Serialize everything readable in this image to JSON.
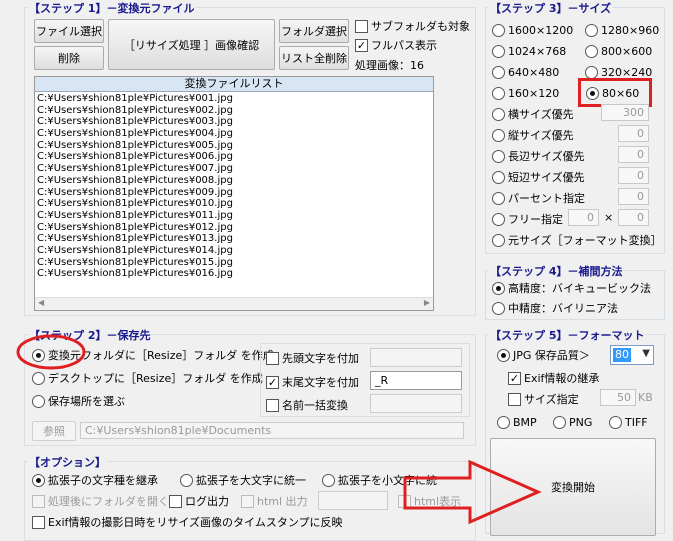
{
  "step1": {
    "title": "【ステップ 1】－変換元ファイル",
    "file_select": "ファイル選択",
    "delete": "削除",
    "resize_confirm": "［リサイズ処理 ］画像確認",
    "folder_select": "フォルダ選択",
    "list_clear": "リスト全削除",
    "subfolder_label": "サブフォルダも対象",
    "fullpath_label": "フルパス表示",
    "processed_label": "処理画像：",
    "processed_count": "16",
    "list_header": "変換ファイルリスト",
    "files": [
      "C:¥Users¥shion81ple¥Pictures¥001.jpg",
      "C:¥Users¥shion81ple¥Pictures¥002.jpg",
      "C:¥Users¥shion81ple¥Pictures¥003.jpg",
      "C:¥Users¥shion81ple¥Pictures¥004.jpg",
      "C:¥Users¥shion81ple¥Pictures¥005.jpg",
      "C:¥Users¥shion81ple¥Pictures¥006.jpg",
      "C:¥Users¥shion81ple¥Pictures¥007.jpg",
      "C:¥Users¥shion81ple¥Pictures¥008.jpg",
      "C:¥Users¥shion81ple¥Pictures¥009.jpg",
      "C:¥Users¥shion81ple¥Pictures¥010.jpg",
      "C:¥Users¥shion81ple¥Pictures¥011.jpg",
      "C:¥Users¥shion81ple¥Pictures¥012.jpg",
      "C:¥Users¥shion81ple¥Pictures¥013.jpg",
      "C:¥Users¥shion81ple¥Pictures¥014.jpg",
      "C:¥Users¥shion81ple¥Pictures¥015.jpg",
      "C:¥Users¥shion81ple¥Pictures¥016.jpg"
    ]
  },
  "step2": {
    "title": "【ステップ 2】－保存先",
    "opt_convert_folder": "変換元フォルダに［Resize］フォルダ を作成",
    "opt_desktop": "デスクトップに［Resize］フォルダ を作成",
    "opt_choose": "保存場所を選ぶ",
    "prefix_label": "先頭文字を付加",
    "suffix_label": "末尾文字を付加",
    "suffix_value": "_R",
    "rename_label": "名前一括変換",
    "browse": "参照",
    "save_path": "C:¥Users¥shion81ple¥Documents"
  },
  "options": {
    "title": "【オプション】",
    "ext_keep": "拡張子の文字種を継承",
    "ext_upper": "拡張子を大文字に統一",
    "ext_lower": "拡張子を小文字に統",
    "open_folder": "処理後にフォルダを開く",
    "log_output": "ログ出力",
    "html_output": "html 出力",
    "html_view": "html表示",
    "exif_timestamp": "Exif情報の撮影日時をリサイズ画像のタイムスタンプに反映"
  },
  "step3": {
    "title": "【ステップ 3】－サイズ",
    "sizes": [
      "1600×1200",
      "1280×960",
      "1024×768",
      "800×600",
      "640×480",
      "320×240",
      "160×120",
      "80×60"
    ],
    "width_priority": "横サイズ優先",
    "width_value": "300",
    "height_priority": "縦サイズ優先",
    "height_value": "0",
    "long_priority": "長辺サイズ優先",
    "long_value": "0",
    "short_priority": "短辺サイズ優先",
    "short_value": "0",
    "percent": "パーセント指定",
    "percent_value": "0",
    "free": "フリー指定",
    "free_w": "0",
    "free_x": "×",
    "free_h": "0",
    "original": "元サイズ［フォーマット変換］"
  },
  "step4": {
    "title": "【ステップ 4】－補間方法",
    "high": "高精度：バイキュービック法",
    "mid": "中精度：バイリニア法"
  },
  "step5": {
    "title": "【ステップ 5】－フォーマット",
    "jpg_label": "JPG 保存品質＞",
    "quality": "80",
    "exif_keep": "Exif情報の継承",
    "size_spec": "サイズ指定",
    "size_value": "50",
    "size_unit": "KB",
    "bmp": "BMP",
    "png": "PNG",
    "tiff": "TIFF",
    "start": "変換開始"
  },
  "colors": {
    "title_blue": "#1a1a8c",
    "annotation_red": "#e02020",
    "list_header_bg": "#d8e6f4",
    "selection_blue": "#3399ff"
  }
}
